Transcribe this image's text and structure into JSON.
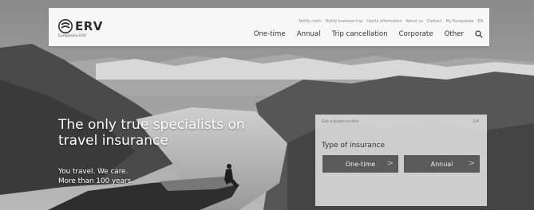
{
  "brand": {
    "name": "ERV",
    "tagline": "Europeiska ERV"
  },
  "header": {
    "utility_links": [
      "Notify claim",
      "Notify business trip",
      "Useful information",
      "About us",
      "Contact",
      "My Europeiska",
      "EN"
    ],
    "nav_items": [
      "One-time",
      "Annual",
      "Trip cancellation",
      "Corporate",
      "Other"
    ],
    "search_icon": "search-icon"
  },
  "hero": {
    "title": "The only true specialists on travel insurance",
    "subtitle_line1": "You travel. We care.",
    "subtitle_line2": "More than 100 years."
  },
  "quote": {
    "heading": "Get a quote on-line",
    "step": "1/4",
    "label": "Type of insurance",
    "options": [
      "One-time",
      "Annual"
    ],
    "chevron": ">"
  },
  "colors": {
    "header_bg": "#f7f7f7",
    "button_bg": "#5a5a5a",
    "hero_text": "#ffffff"
  }
}
